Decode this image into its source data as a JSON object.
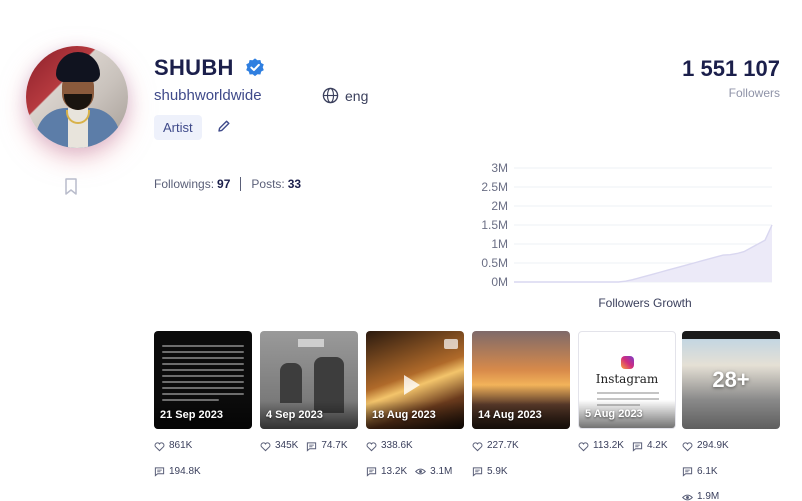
{
  "profile": {
    "name": "SHUBH",
    "handle": "shubhworldwide",
    "language": "eng",
    "category": "Artist",
    "followers_count": "1 551 107",
    "followers_label": "Followers"
  },
  "stats": {
    "followings_label": "Followings:",
    "followings_value": "97",
    "posts_label": "Posts:",
    "posts_value": "33"
  },
  "chart_data": {
    "type": "area",
    "title": "",
    "xlabel": "Followers Growth",
    "ylabel": "",
    "y_ticks": [
      "3M",
      "2.5M",
      "2M",
      "1.5M",
      "1M",
      "0.5M",
      "0M"
    ],
    "ylim": [
      0,
      3000000
    ],
    "series": [
      {
        "values": [
          0,
          0,
          0,
          0,
          0,
          0,
          0,
          0,
          0,
          0,
          0,
          0,
          0,
          0,
          0,
          0,
          20000,
          60000,
          110000,
          160000,
          210000,
          260000,
          310000,
          360000,
          410000,
          460000,
          510000,
          560000,
          610000,
          660000,
          710000,
          720000,
          750000,
          800000,
          900000,
          1000000,
          1100000,
          1500000
        ]
      }
    ]
  },
  "posts": [
    {
      "date": "21 Sep 2023",
      "likes": "861K",
      "comments": "194.8K",
      "views": ""
    },
    {
      "date": "4 Sep 2023",
      "likes": "345K",
      "comments": "74.7K",
      "views": ""
    },
    {
      "date": "18 Aug 2023",
      "likes": "338.6K",
      "comments": "13.2K",
      "views": "3.1M"
    },
    {
      "date": "14 Aug 2023",
      "likes": "227.7K",
      "comments": "5.9K",
      "views": ""
    },
    {
      "date": "5 Aug 2023",
      "likes": "113.2K",
      "comments": "4.2K",
      "views": ""
    },
    {
      "date": "",
      "likes": "294.9K",
      "comments": "6.1K",
      "views": "1.9M",
      "overlay": "28+"
    }
  ],
  "thumb_text": {
    "instagram": "Instagram"
  },
  "colors": {
    "brand": "#1b1f4b",
    "accent": "#3f4a8a",
    "verified": "#2f7fe0",
    "chart_fill": "#eceaf8"
  },
  "icons": {
    "verified": "verified-badge-icon",
    "globe": "globe-icon",
    "edit": "pencil-icon",
    "bookmark": "bookmark-icon",
    "like": "heart-icon",
    "comment": "comment-icon",
    "view": "eye-icon"
  }
}
